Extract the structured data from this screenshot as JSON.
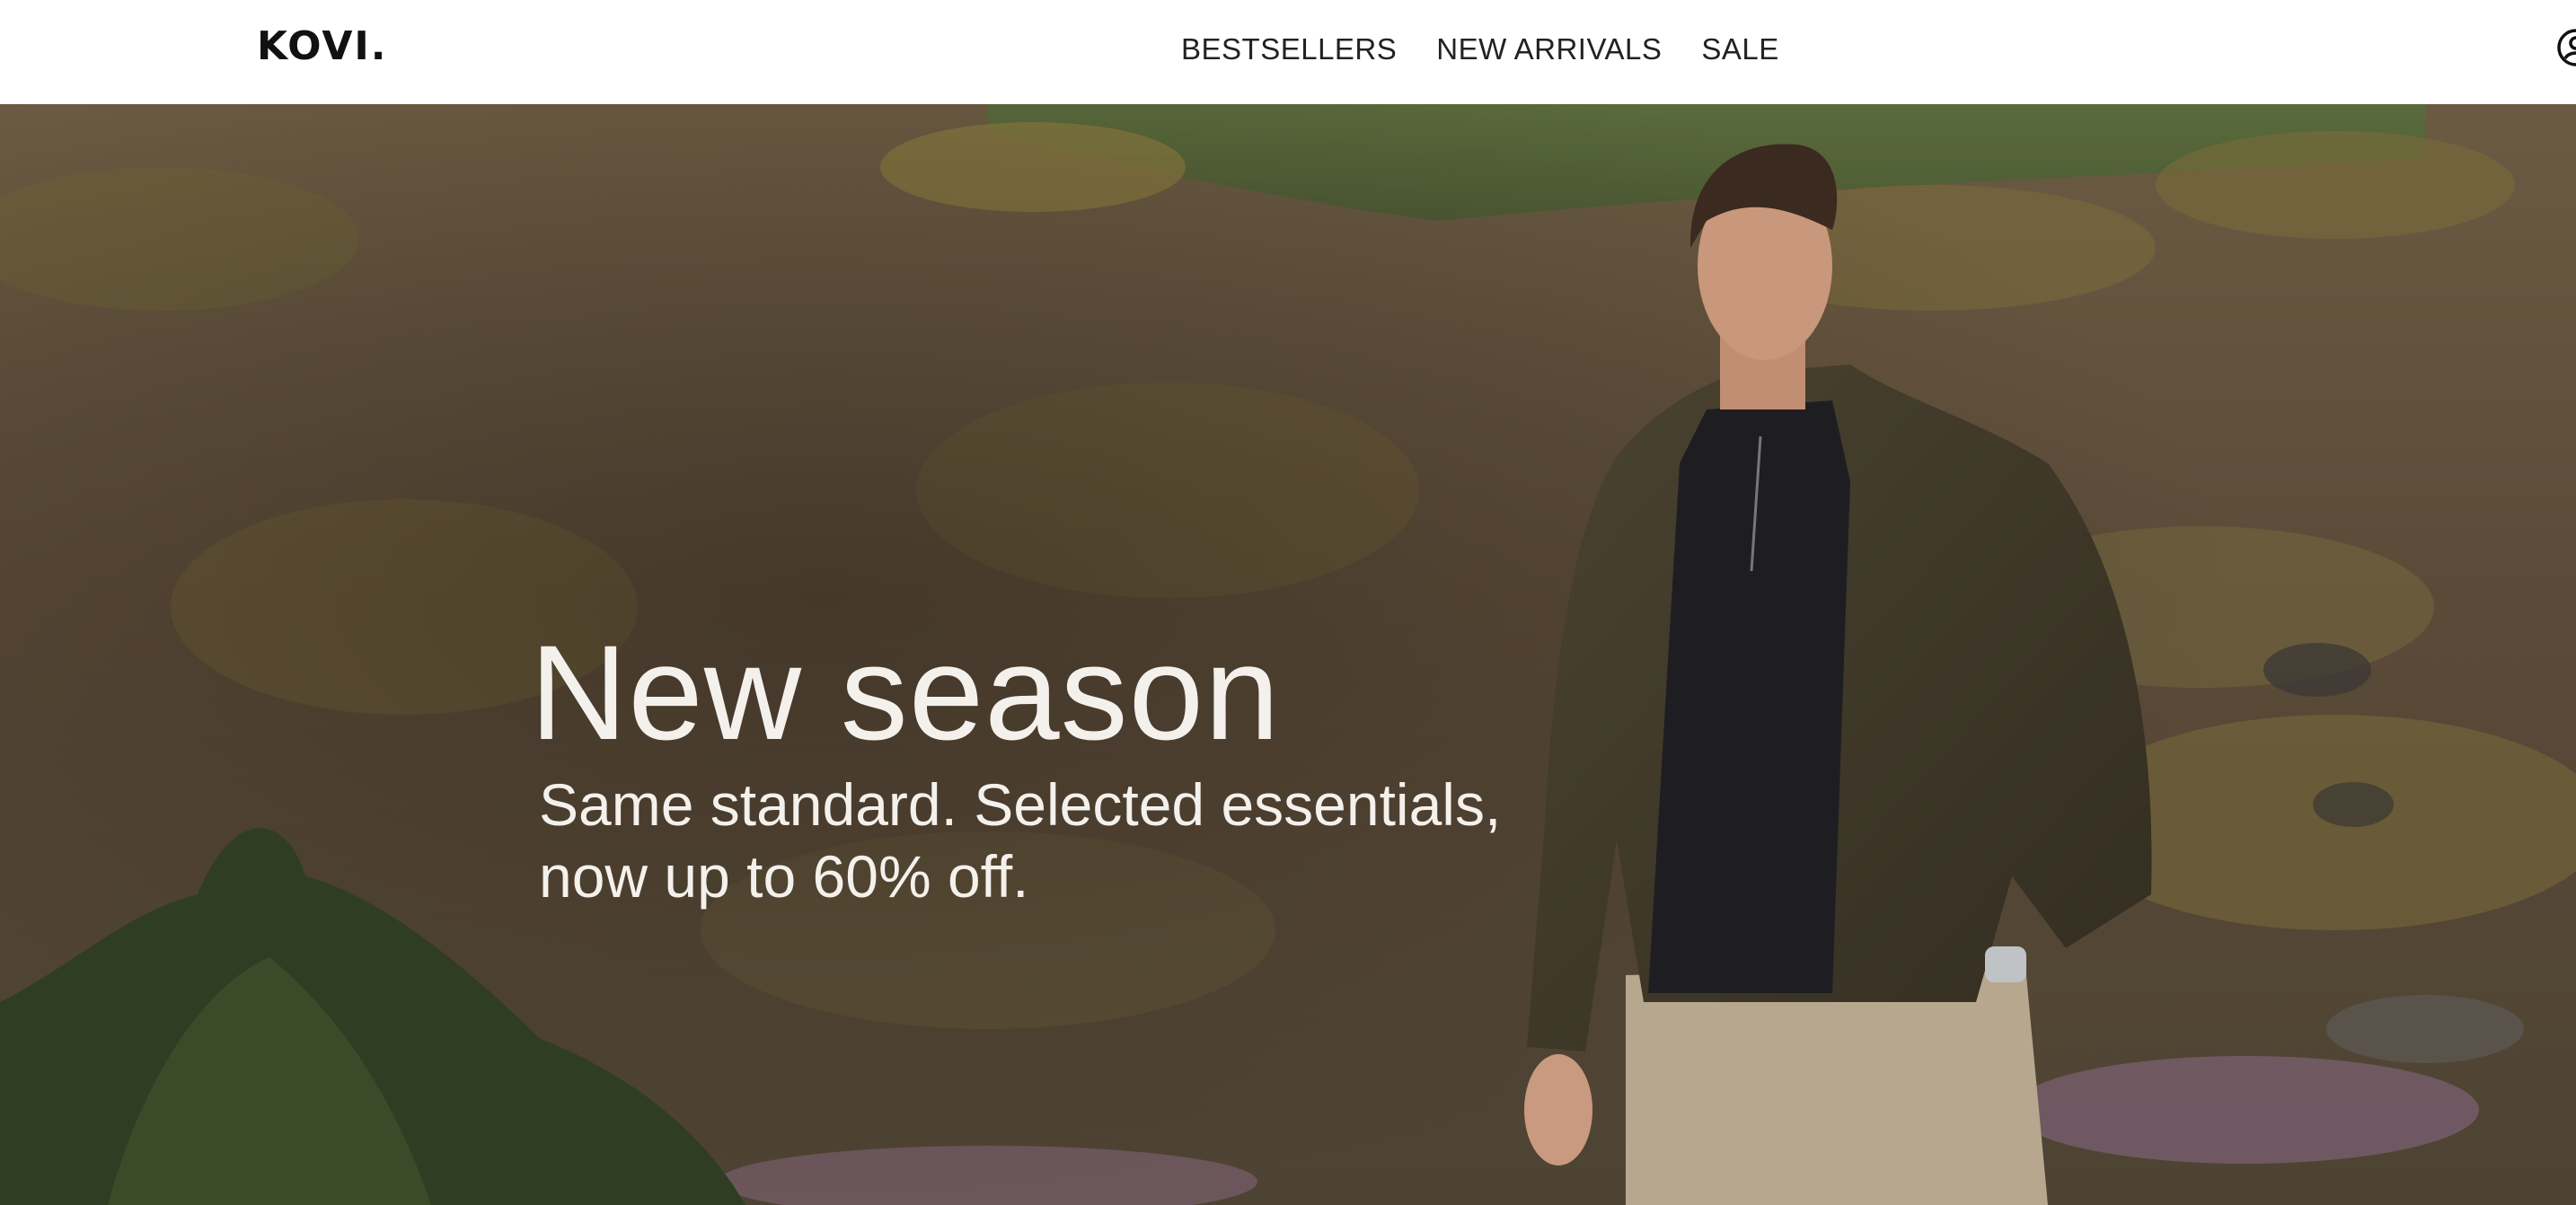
{
  "header": {
    "logo": "KOVI.",
    "nav": [
      {
        "label": "BESTSELLERS"
      },
      {
        "label": "NEW ARRIVALS"
      },
      {
        "label": "SALE"
      }
    ],
    "account_icon": "user-account-icon"
  },
  "hero": {
    "headline": "New season",
    "subline": "Same standard. Selected essentials, now up to 60% off.",
    "image": "man-in-suede-jacket-on-mossy-hillside"
  },
  "colors": {
    "header_bg": "#ffffff",
    "hero_text": "#f4f1ec",
    "nav_text": "#222222"
  }
}
